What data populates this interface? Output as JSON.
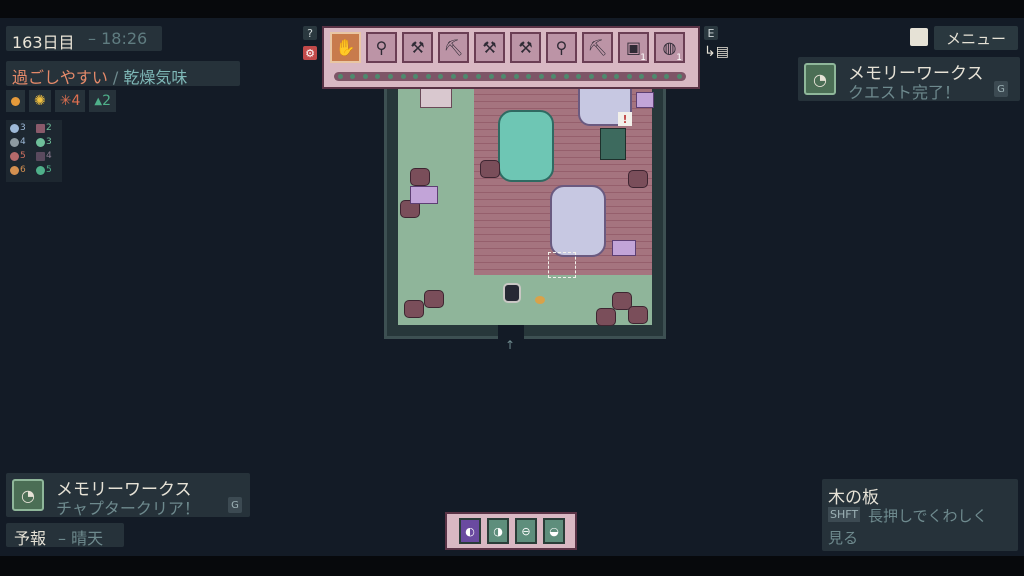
{
  "hud": {
    "day": "163日目",
    "time": "– 18:26",
    "comfort_good": "過ごしやすい",
    "comfort_sep": " / ",
    "comfort_dry": "乾燥気味",
    "stats": [
      {
        "icon": "sun-orange-icon",
        "value": ""
      },
      {
        "icon": "sun-yellow-icon",
        "value": ""
      },
      {
        "icon": "star-icon",
        "value": "4"
      },
      {
        "icon": "water-drop-icon",
        "value": "2"
      }
    ],
    "resources": [
      {
        "icon": "moon-icon",
        "value": "3",
        "color": "#9db8d6"
      },
      {
        "icon": "box-icon",
        "value": "2",
        "color": "#8a5a6a"
      },
      {
        "icon": "gray-orb-icon",
        "value": "4",
        "color": "#8e9aa0"
      },
      {
        "icon": "leaf-icon",
        "value": "3",
        "color": "#6fbf9a"
      },
      {
        "icon": "red-orb-icon",
        "value": "5",
        "color": "#b56a6a"
      },
      {
        "icon": "dark-box-icon",
        "value": "4",
        "color": "#5a4a5e"
      },
      {
        "icon": "orange-orb-icon",
        "value": "6",
        "color": "#d49050"
      },
      {
        "icon": "green-clover-icon",
        "value": "5",
        "color": "#4fb08a"
      }
    ]
  },
  "toolbar": {
    "help": "?",
    "key_e": "E",
    "slots": [
      {
        "icon": "hand-icon",
        "count": "",
        "selected": true
      },
      {
        "icon": "magnifier-icon",
        "count": ""
      },
      {
        "icon": "axe-icon",
        "count": ""
      },
      {
        "icon": "pickaxe-icon",
        "count": ""
      },
      {
        "icon": "hammer-icon",
        "count": ""
      },
      {
        "icon": "wrench-icon",
        "count": ""
      },
      {
        "icon": "shovel-icon",
        "count": ""
      },
      {
        "icon": "scythe-icon",
        "count": ""
      },
      {
        "icon": "crate-icon",
        "count": "1"
      },
      {
        "icon": "barrel-icon",
        "count": "1"
      }
    ]
  },
  "menu": {
    "label": "メニュー"
  },
  "quest": {
    "title": "メモリーワークス",
    "status": "クエスト完了！",
    "key": "G"
  },
  "notice": {
    "title": "メモリーワークス",
    "status": "チャプタークリア！",
    "key": "G"
  },
  "forecast": {
    "label": "予報",
    "value": "– 晴天"
  },
  "tooltip": {
    "title": "木の板",
    "key": "SHFT",
    "text1": "長押しでくわしく",
    "text2": "見る"
  },
  "hotbar": [
    "purple-orb-icon",
    "green-orb-icon",
    "teal-orb-icon",
    "teal-orb-icon-2"
  ]
}
